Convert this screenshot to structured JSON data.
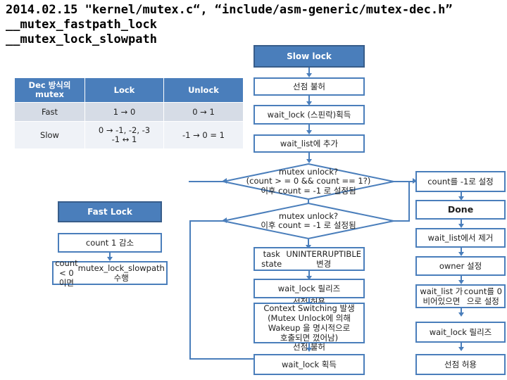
{
  "slide": {
    "title_lines": [
      "2014.02.15 \"kernel/mutex.c“, “include/asm-generic/mutex-dec.h”",
      "__mutex_fastpath_lock",
      "__mutex_lock_slowpath"
    ]
  },
  "table": {
    "headers": [
      "Dec 방식의 mutex",
      "Lock",
      "Unlock"
    ],
    "rows": [
      [
        "Fast",
        "1 → 0",
        "0 → 1"
      ],
      [
        "Slow",
        "0 → -1, -2, -3\n-1 ↔ 1",
        "-1 → 0 = 1"
      ]
    ]
  },
  "fast_path": {
    "header": "Fast Lock",
    "steps": [
      "count 1 감소",
      "count < 0 이면\nmutex_lock_slowpath 수행"
    ]
  },
  "slow_path": {
    "header": "Slow lock",
    "steps": [
      "선점 불허",
      "wait_lock (스핀락)획득",
      "wait_list에 추가"
    ],
    "decisions": [
      {
        "lines": [
          "mutex unlock?",
          "(count > = 0 && count == 1?)",
          "이후 count = -1 로 설정됨"
        ]
      },
      {
        "lines": [
          "mutex unlock?",
          "이후 count = -1 로 설정됨"
        ]
      }
    ],
    "after_decision": [
      "task state\nUNINTERRUPTIBLE 변경",
      "wait_lock 릴리즈",
      "Context Switching 발생\n(Mutex Unlock에 의해\nWakeup 을 명시적으로\n호출되면 껐어남)",
      "wait_lock 획득"
    ],
    "inline_labels": [
      "선점 허용",
      "선점 불허"
    ]
  },
  "done_path": {
    "steps": [
      "count를 -1로 설정",
      "Done",
      "wait_list에서 제거",
      "owner 설정",
      "wait_list 가 비어있으면\ncount를 0으로 설정",
      "wait_lock 릴리즈",
      "선점 허용"
    ]
  },
  "colors": {
    "accent": "#4A7EBB",
    "accent_dark": "#385D8A",
    "row_a": "#D6DCE6",
    "row_b": "#EFF2F7"
  }
}
